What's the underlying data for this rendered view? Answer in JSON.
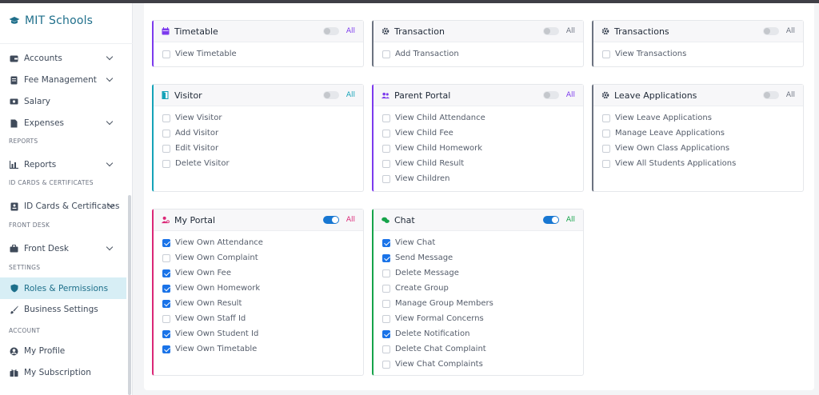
{
  "brand": {
    "name": "MIT Schools"
  },
  "sidebar": {
    "items": [
      {
        "label": "Accounts",
        "icon": "wallet-icon",
        "chevron": true
      },
      {
        "label": "Fee Management",
        "icon": "receipt-icon",
        "chevron": true
      },
      {
        "label": "Salary",
        "icon": "money-icon",
        "chevron": false
      },
      {
        "label": "Expenses",
        "icon": "file-icon",
        "chevron": true
      },
      {
        "label": "Reports",
        "icon": "bar-chart-icon",
        "chevron": true
      },
      {
        "label": "ID Cards & Certificates",
        "icon": "id-card-icon",
        "chevron": true
      },
      {
        "label": "Front Desk",
        "icon": "briefcase-icon",
        "chevron": true
      },
      {
        "label": "Roles & Permissions",
        "icon": "shield-icon",
        "chevron": false,
        "active": true
      },
      {
        "label": "Business Settings",
        "icon": "brush-icon",
        "chevron": false
      },
      {
        "label": "My Profile",
        "icon": "user-circle-icon",
        "chevron": false
      },
      {
        "label": "My Subscription",
        "icon": "gift-icon",
        "chevron": false
      }
    ],
    "sections": [
      "REPORTS",
      "ID CARDS & CERTIFICATES",
      "FRONT DESK",
      "SETTINGS",
      "ACCOUNT"
    ]
  },
  "cards": {
    "timetable": {
      "title": "Timetable",
      "all": "All",
      "accent": "#7c3aed",
      "toggle": false,
      "items": [
        {
          "label": "View Timetable",
          "checked": false
        }
      ]
    },
    "transaction": {
      "title": "Transaction",
      "all": "All",
      "accent": "#6b7280",
      "toggle": false,
      "items": [
        {
          "label": "Add Transaction",
          "checked": false
        }
      ]
    },
    "transactions": {
      "title": "Transactions",
      "all": "All",
      "accent": "#6b7280",
      "toggle": false,
      "items": [
        {
          "label": "View Transactions",
          "checked": false
        }
      ]
    },
    "visitor": {
      "title": "Visitor",
      "all": "All",
      "accent": "#14a3b8",
      "toggle": false,
      "items": [
        {
          "label": "View Visitor",
          "checked": false
        },
        {
          "label": "Add Visitor",
          "checked": false
        },
        {
          "label": "Edit Visitor",
          "checked": false
        },
        {
          "label": "Delete Visitor",
          "checked": false
        }
      ]
    },
    "parent_portal": {
      "title": "Parent Portal",
      "all": "All",
      "accent": "#7c3aed",
      "toggle": false,
      "items": [
        {
          "label": "View Child Attendance",
          "checked": false
        },
        {
          "label": "View Child Fee",
          "checked": false
        },
        {
          "label": "View Child Homework",
          "checked": false
        },
        {
          "label": "View Child Result",
          "checked": false
        },
        {
          "label": "View Children",
          "checked": false
        }
      ]
    },
    "leave_applications": {
      "title": "Leave Applications",
      "all": "All",
      "accent": "#6b7280",
      "toggle": false,
      "items": [
        {
          "label": "View Leave Applications",
          "checked": false
        },
        {
          "label": "Manage Leave Applications",
          "checked": false
        },
        {
          "label": "View Own Class Applications",
          "checked": false
        },
        {
          "label": "View All Students Applications",
          "checked": false
        }
      ]
    },
    "my_portal": {
      "title": "My Portal",
      "all": "All",
      "accent": "#db2777",
      "toggle": true,
      "items": [
        {
          "label": "View Own Attendance",
          "checked": true
        },
        {
          "label": "View Own Complaint",
          "checked": false
        },
        {
          "label": "View Own Fee",
          "checked": true
        },
        {
          "label": "View Own Homework",
          "checked": true
        },
        {
          "label": "View Own Result",
          "checked": true
        },
        {
          "label": "View Own Staff Id",
          "checked": false
        },
        {
          "label": "View Own Student Id",
          "checked": true
        },
        {
          "label": "View Own Timetable",
          "checked": true
        }
      ]
    },
    "chat": {
      "title": "Chat",
      "all": "All",
      "accent": "#16a34a",
      "toggle": true,
      "items": [
        {
          "label": "View Chat",
          "checked": true
        },
        {
          "label": "Send Message",
          "checked": true
        },
        {
          "label": "Delete Message",
          "checked": false
        },
        {
          "label": "Create Group",
          "checked": false
        },
        {
          "label": "Manage Group Members",
          "checked": false
        },
        {
          "label": "View Formal Concerns",
          "checked": false
        },
        {
          "label": "Delete Notification",
          "checked": true
        },
        {
          "label": "Delete Chat Complaint",
          "checked": false
        },
        {
          "label": "View Chat Complaints",
          "checked": false
        }
      ]
    }
  }
}
